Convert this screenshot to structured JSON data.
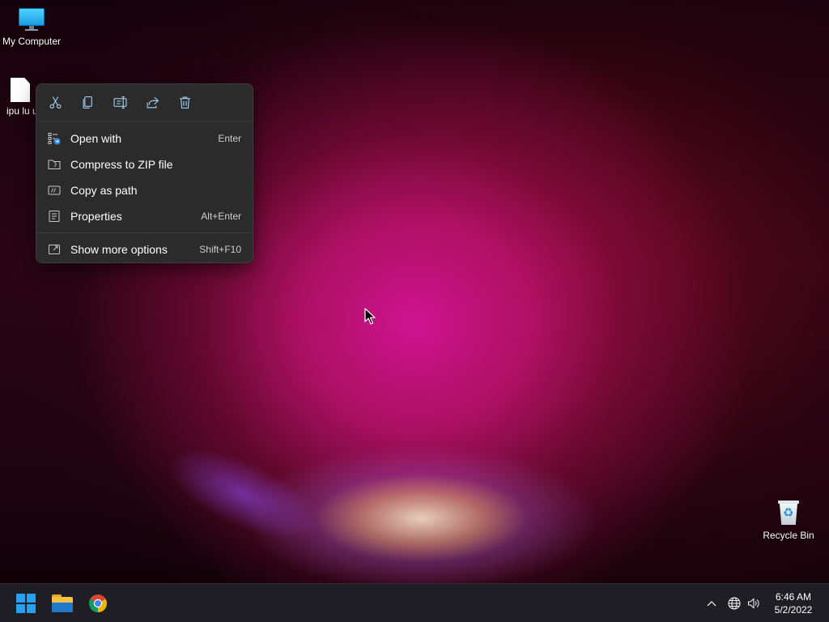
{
  "desktop": {
    "icons": [
      {
        "label": "My Computer",
        "icon": "computer-icon"
      },
      {
        "label": "ipu lu u",
        "icon": "text-file-icon"
      },
      {
        "label": "Recycle Bin",
        "icon": "recycle-bin-icon"
      }
    ]
  },
  "context_menu": {
    "quick_actions": [
      {
        "name": "cut",
        "icon": "scissors-icon"
      },
      {
        "name": "copy",
        "icon": "copy-icon"
      },
      {
        "name": "rename",
        "icon": "rename-icon"
      },
      {
        "name": "share",
        "icon": "share-icon"
      },
      {
        "name": "delete",
        "icon": "trash-icon"
      }
    ],
    "items": [
      {
        "label": "Open with",
        "shortcut": "Enter",
        "icon": "open-with-icon"
      },
      {
        "label": "Compress to ZIP file",
        "shortcut": "",
        "icon": "zip-folder-icon"
      },
      {
        "label": "Copy as path",
        "shortcut": "",
        "icon": "copy-path-icon"
      },
      {
        "label": "Properties",
        "shortcut": "Alt+Enter",
        "icon": "properties-icon"
      },
      {
        "label": "Show more options",
        "shortcut": "Shift+F10",
        "icon": "more-options-icon"
      }
    ]
  },
  "taskbar": {
    "pinned": [
      {
        "name": "Start",
        "icon": "windows-start-icon"
      },
      {
        "name": "File Explorer",
        "icon": "folder-icon"
      },
      {
        "name": "Google Chrome",
        "icon": "chrome-icon"
      }
    ],
    "tray": {
      "icons": [
        "chevron-up-icon",
        "network-globe-icon",
        "volume-icon"
      ],
      "time": "6:46 AM",
      "date": "5/2/2022"
    }
  },
  "colors": {
    "menu_background": "#2b2b2b",
    "taskbar_background": "#1e1e24",
    "start_accent": "#26a0f2"
  }
}
